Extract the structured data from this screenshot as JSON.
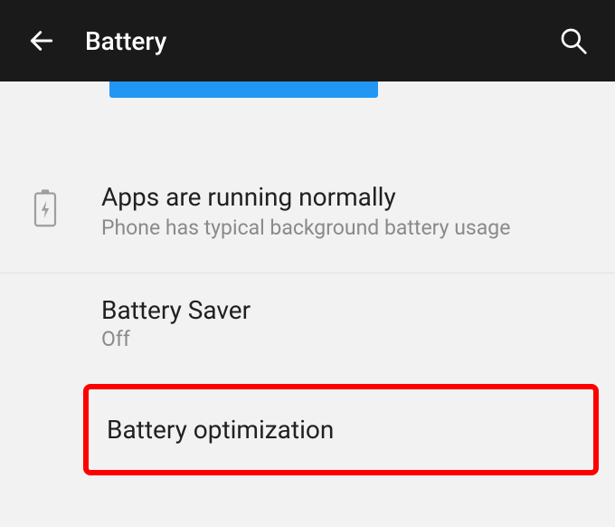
{
  "header": {
    "title": "Battery"
  },
  "status": {
    "title": "Apps are running normally",
    "subtitle": "Phone has typical background battery usage"
  },
  "battery_saver": {
    "title": "Battery Saver",
    "value": "Off"
  },
  "battery_optimization": {
    "title": "Battery optimization"
  }
}
